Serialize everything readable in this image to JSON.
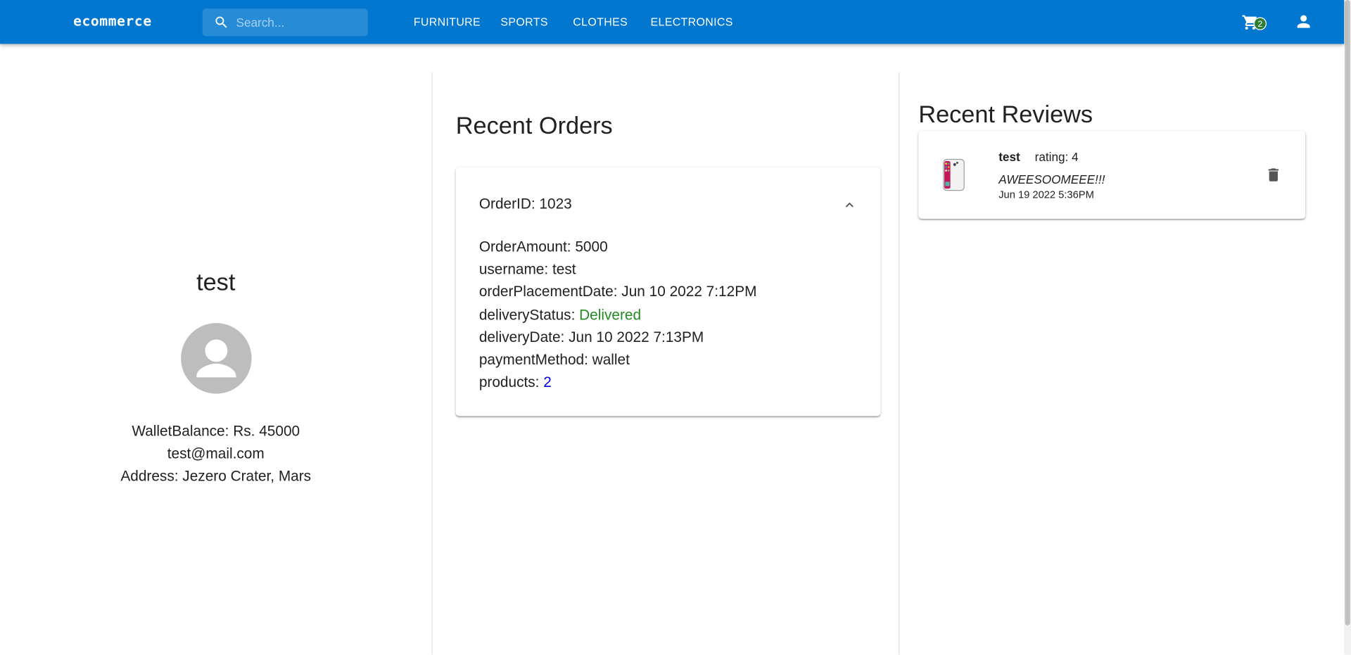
{
  "appbar": {
    "brand": "ecommerce",
    "search_placeholder": "Search...",
    "nav": [
      "FURNITURE",
      "SPORTS",
      "CLOTHES",
      "ELECTRONICS"
    ],
    "cart_count": "2",
    "colors": {
      "bar": "#0277cf",
      "badge": "#2e7d32"
    }
  },
  "profile": {
    "name": "test",
    "wallet": "WalletBalance: Rs. 45000",
    "email": "test@mail.com",
    "address": "Address: Jezero Crater, Mars"
  },
  "orders": {
    "title": "Recent Orders",
    "items": [
      {
        "id_line": "OrderID: 1023",
        "amount_line": "OrderAmount: 5000",
        "username_line": "username: test",
        "placed_line": "orderPlacementDate: Jun 10 2022 7:12PM",
        "status_label": "deliveryStatus: ",
        "status_value": "Delivered",
        "delivery_line": "deliveryDate: Jun 10 2022 7:13PM",
        "payment_line": "paymentMethod: wallet",
        "products_label": "products: ",
        "products_value": "2"
      }
    ]
  },
  "reviews": {
    "title": "Recent Reviews",
    "items": [
      {
        "user": "test",
        "rating": "rating: 4",
        "text": "AWEESOOMEEE!!!",
        "date": "Jun 19 2022 5:36PM"
      }
    ]
  }
}
